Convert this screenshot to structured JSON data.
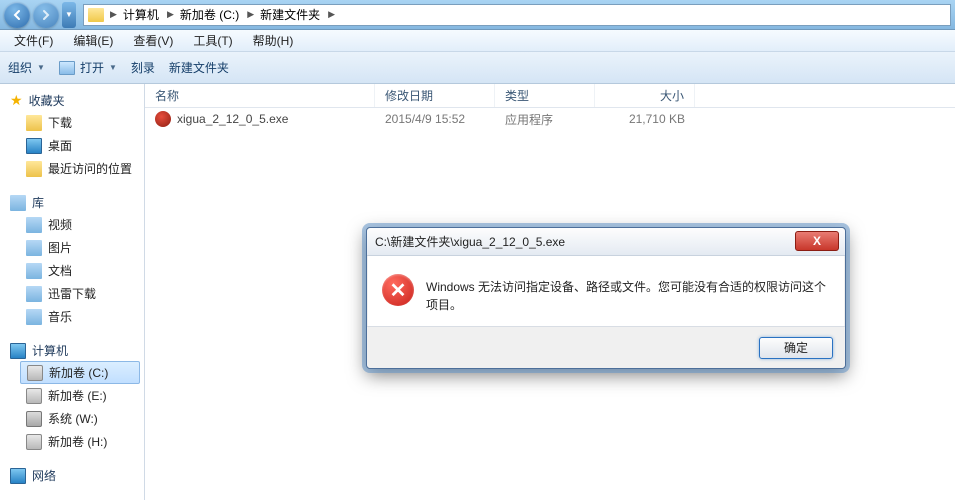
{
  "breadcrumb": {
    "items": [
      "计算机",
      "新加卷 (C:)",
      "新建文件夹"
    ]
  },
  "menubar": {
    "file": "文件(F)",
    "edit": "编辑(E)",
    "view": "查看(V)",
    "tools": "工具(T)",
    "help": "帮助(H)"
  },
  "toolbar": {
    "organize": "组织",
    "open": "打开",
    "burn": "刻录",
    "newfolder": "新建文件夹"
  },
  "sidebar": {
    "favorites": {
      "label": "收藏夹",
      "items": [
        "下载",
        "桌面",
        "最近访问的位置"
      ]
    },
    "libraries": {
      "label": "库",
      "items": [
        "视频",
        "图片",
        "文档",
        "迅雷下载",
        "音乐"
      ]
    },
    "computer": {
      "label": "计算机",
      "items": [
        "新加卷 (C:)",
        "新加卷 (E:)",
        "系统 (W:)",
        "新加卷 (H:)"
      ]
    },
    "network": {
      "label": "网络"
    }
  },
  "columns": {
    "name": "名称",
    "date": "修改日期",
    "type": "类型",
    "size": "大小"
  },
  "files": [
    {
      "name": "xigua_2_12_0_5.exe",
      "date": "2015/4/9 15:52",
      "type": "应用程序",
      "size": "21,710 KB"
    }
  ],
  "dialog": {
    "title": "C:\\新建文件夹\\xigua_2_12_0_5.exe",
    "message": "Windows 无法访问指定设备、路径或文件。您可能没有合适的权限访问这个项目。",
    "ok": "确定",
    "close": "X"
  }
}
